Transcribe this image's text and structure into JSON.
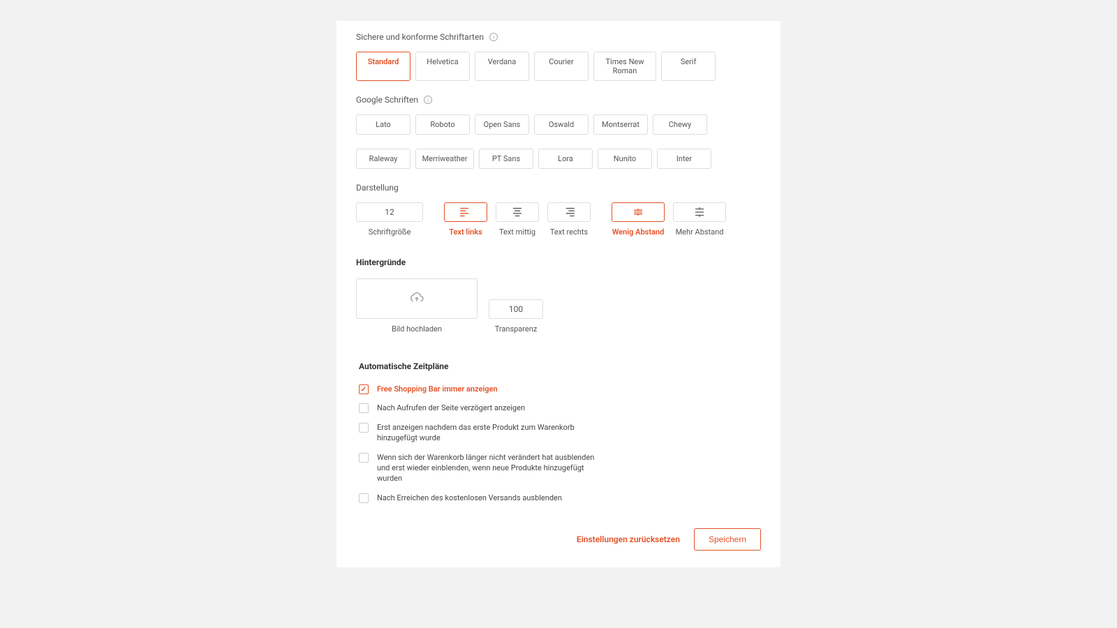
{
  "safe_fonts": {
    "label": "Sichere und konforme Schriftarten",
    "options": [
      "Standard",
      "Helvetica",
      "Verdana",
      "Courier",
      "Times New Roman",
      "Serif"
    ],
    "active": "Standard"
  },
  "google_fonts": {
    "label": "Google Schriften",
    "options": [
      "Lato",
      "Roboto",
      "Open Sans",
      "Oswald",
      "Montserrat",
      "Chewy",
      "Raleway",
      "Merriweather",
      "PT Sans",
      "Lora",
      "Nunito",
      "Inter"
    ]
  },
  "display": {
    "label": "Darstellung",
    "font_size": {
      "value": "12",
      "caption": "Schriftgröße"
    },
    "align": [
      {
        "id": "left",
        "caption": "Text links"
      },
      {
        "id": "center",
        "caption": "Text mittig"
      },
      {
        "id": "right",
        "caption": "Text rechts"
      }
    ],
    "align_active": "left",
    "spacing": [
      {
        "id": "tight",
        "caption": "Wenig Abstand"
      },
      {
        "id": "loose",
        "caption": "Mehr Abstand"
      }
    ],
    "spacing_active": "tight"
  },
  "backgrounds": {
    "heading": "Hintergründe",
    "upload_caption": "Bild hochladen",
    "transparency": {
      "value": "100",
      "caption": "Transparenz"
    }
  },
  "schedules": {
    "heading": "Automatische Zeitpläne",
    "items": [
      {
        "id": "always",
        "label": "Free Shopping Bar immer anzeigen",
        "checked": true
      },
      {
        "id": "delayed",
        "label": "Nach Aufrufen der Seite verzögert anzeigen",
        "checked": false
      },
      {
        "id": "after-first",
        "label": "Erst anzeigen nachdem das erste Produkt zum Warenkorb hinzugefügt wurde",
        "checked": false
      },
      {
        "id": "idle-cart",
        "label": "Wenn sich der Warenkorb länger nicht verändert hat ausblenden und erst wieder einblenden, wenn neue Produkte hinzugefügt wurden",
        "checked": false
      },
      {
        "id": "after-free",
        "label": "Nach Erreichen des kostenlosen Versands ausblenden",
        "checked": false
      }
    ]
  },
  "footer": {
    "reset": "Einstellungen zurücksetzen",
    "save": "Speichern"
  }
}
